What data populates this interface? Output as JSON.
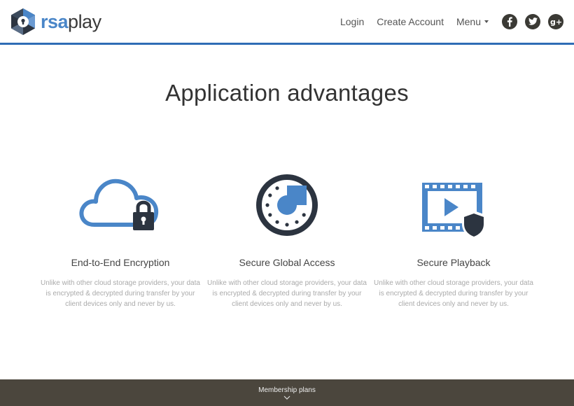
{
  "brand": {
    "logo_rsa": "rsa",
    "logo_play": "play"
  },
  "nav": {
    "login": "Login",
    "create_account": "Create Account",
    "menu": "Menu",
    "social": [
      "facebook-icon",
      "twitter-icon",
      "google-plus-icon"
    ]
  },
  "main": {
    "title": "Application advantages",
    "features": [
      {
        "icon": "cloud-lock-icon",
        "title": "End-to-End Encryption",
        "description": "Unlike with other cloud storage providers, your data is encrypted & decrypted during transfer by your client devices only and never by us."
      },
      {
        "icon": "secure-dial-icon",
        "title": "Secure Global Access",
        "description": "Unlike with other cloud storage providers, your data is encrypted & decrypted during transfer by your client devices only and never by us."
      },
      {
        "icon": "film-shield-icon",
        "title": "Secure Playback",
        "description": "Unlike with other cloud storage providers, your data is encrypted & decrypted during transfer by your client devices only and never by us."
      }
    ]
  },
  "footer": {
    "label": "Membership plans"
  },
  "colors": {
    "accent_blue": "#2f6db5",
    "icon_blue": "#4a86c8",
    "icon_dark": "#2c3440",
    "footer_bg": "#4b463d"
  }
}
